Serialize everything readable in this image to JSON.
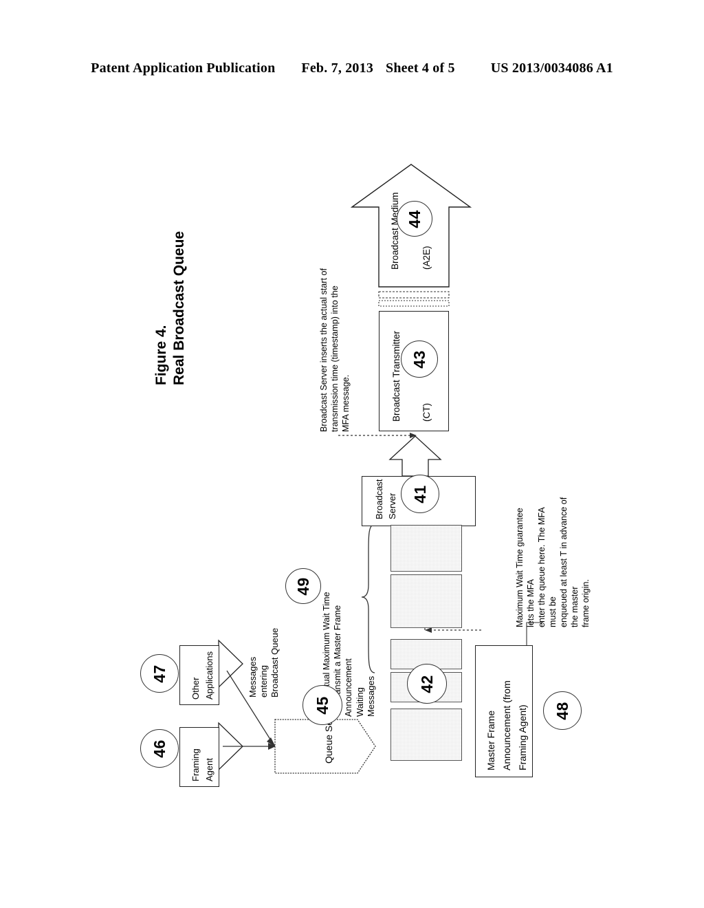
{
  "header": {
    "publication": "Patent Application Publication",
    "date": "Feb. 7, 2013",
    "sheet": "Sheet 4 of 5",
    "number": "US 2013/0034086 A1"
  },
  "figure": {
    "label": "Figure 4.",
    "title": "Real Broadcast Queue"
  },
  "nodes": {
    "broadcast_medium": {
      "line1": "Broadcast Medium",
      "line2": "(A2E)",
      "ref": "44"
    },
    "broadcast_transmitter": {
      "line1": "Broadcast Transmitter",
      "line2": "(CT)",
      "ref": "43"
    },
    "broadcast_server": {
      "line1": "Broadcast",
      "line2": "Server",
      "ref": "41"
    },
    "queue_server": {
      "label": "Queue Server",
      "ref": "45"
    },
    "framing_agent": {
      "line1": "Framing",
      "line2": "Agent",
      "ref": "46"
    },
    "other_applications": {
      "line1": "Other",
      "line2": "Applications",
      "ref": "47"
    },
    "master_frame_announcement": {
      "line1": "Master Frame",
      "line2": "Announcement (from",
      "line3": "Framing Agent)",
      "ref": "48"
    },
    "waiting_queue": {
      "ref": "42"
    },
    "wait_time_bracket": {
      "ref": "49"
    }
  },
  "labels": {
    "messages_entering": {
      "line1": "Messages",
      "line2": "entering",
      "line3": "Broadcast Queue"
    },
    "waiting_messages": {
      "line1": "Waiting",
      "line2": "Messages"
    }
  },
  "annotations": {
    "timestamp_note": {
      "line1": "Broadcast Server inserts the actual start of",
      "line2": "transmission time (timestamp) into the",
      "line3": "MFA message."
    },
    "wait_time_note": {
      "line1": "Contractual Maximum Wait Time",
      "line2": "T to transmit a Master Frame",
      "line3": "Announcement"
    },
    "mfa_enqueue_note": {
      "line1": "Maximum Wait Time guarantee lets the MFA",
      "line2": "enter the queue here. The MFA must be",
      "line3": "enqueued at least T in advance of the master",
      "line4": "frame origin."
    }
  },
  "colors": {
    "ink": "#000000",
    "outline": "#222222",
    "hatch_fill": "#dedede",
    "background": "#ffffff"
  }
}
